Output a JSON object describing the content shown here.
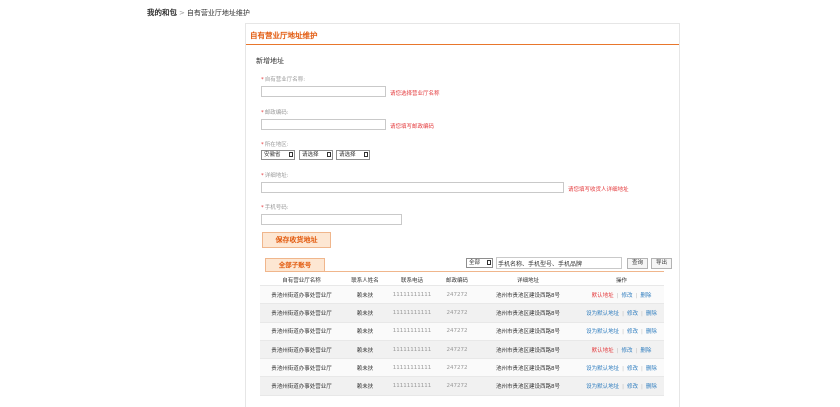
{
  "breadcrumb": {
    "home": "我的和包",
    "sep": ">",
    "current": "自有营业厅地址维护"
  },
  "panel": {
    "title": "自有营业厅地址维护",
    "section_title": "新增地址"
  },
  "form": {
    "hall_name": {
      "label": "自有营业厅名称:",
      "required": "*",
      "value": "",
      "error": "请您选择营业厅名称"
    },
    "zip": {
      "label": "邮政编码:",
      "required": "*",
      "value": "",
      "error": "请您填写邮政编码"
    },
    "region": {
      "label": "所在地区:",
      "required": "*",
      "province": "安徽省",
      "city": "请选择",
      "district": "请选择"
    },
    "address": {
      "label": "详细地址:",
      "required": "*",
      "value": "",
      "error": "请您填写收货人详细地址"
    },
    "phone": {
      "label": "手机号码:",
      "required": "*",
      "value": ""
    },
    "save_label": "保存收货地址"
  },
  "list": {
    "tab_label": "全部子账号",
    "filter_value": "全部",
    "search_placeholder": "手机名称、手机型号、手机品牌",
    "query_label": "查询",
    "export_label": "导出",
    "columns": [
      "自有营业厅名称",
      "联系人姓名",
      "联系电话",
      "邮政编码",
      "详细地址",
      "操作"
    ],
    "rows": [
      {
        "name": "贵池州街道办事处营业厅",
        "contact": "赖未扶",
        "phone": "11111111111",
        "zip": "247272",
        "address": "池州市贵池区建设西路8号",
        "action1": "默认地址",
        "action2": "修改",
        "action3": "删除",
        "default": true
      },
      {
        "name": "贵池州街道办事处营业厅",
        "contact": "赖未扶",
        "phone": "11111111111",
        "zip": "247272",
        "address": "池州市贵池区建设西路8号",
        "action1": "设为默认地址",
        "action2": "修改",
        "action3": "删除",
        "default": false
      },
      {
        "name": "贵池州街道办事处营业厅",
        "contact": "赖未扶",
        "phone": "11111111111",
        "zip": "247272",
        "address": "池州市贵池区建设西路8号",
        "action1": "设为默认地址",
        "action2": "修改",
        "action3": "删除",
        "default": false
      },
      {
        "name": "贵池州街道办事处营业厅",
        "contact": "赖未扶",
        "phone": "11111111111",
        "zip": "247272",
        "address": "池州市贵池区建设西路8号",
        "action1": "默认地址",
        "action2": "修改",
        "action3": "删除",
        "default": true
      },
      {
        "name": "贵池州街道办事处营业厅",
        "contact": "赖未扶",
        "phone": "11111111111",
        "zip": "247272",
        "address": "池州市贵池区建设西路8号",
        "action1": "设为默认地址",
        "action2": "修改",
        "action3": "删除",
        "default": false
      },
      {
        "name": "贵池州街道办事处营业厅",
        "contact": "赖未扶",
        "phone": "11111111111",
        "zip": "247272",
        "address": "池州市贵池区建设西路8号",
        "action1": "设为默认地址",
        "action2": "修改",
        "action3": "删除",
        "default": false
      }
    ]
  },
  "colors": {
    "accent": "#e25a0e",
    "error": "#e4393c",
    "link": "#2f7dbf"
  }
}
